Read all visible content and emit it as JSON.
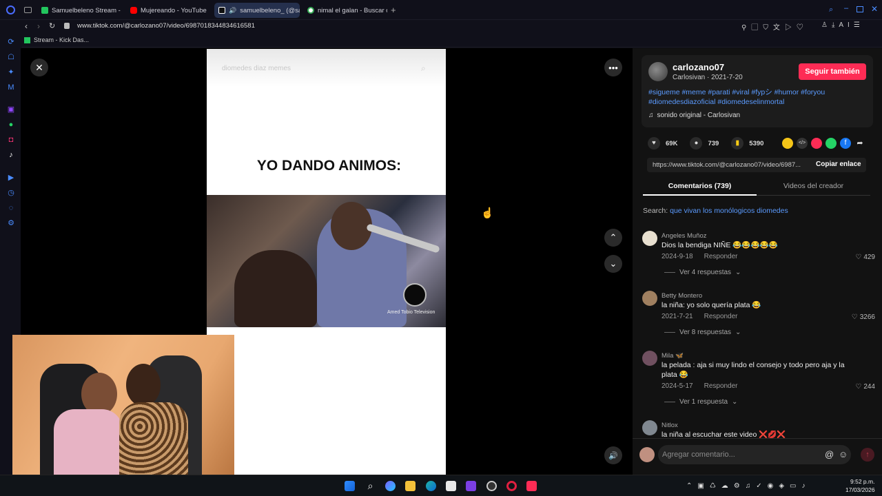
{
  "browser": {
    "tabs": [
      {
        "label": "Samuelbeleno Stream - W",
        "color": "#22c55e"
      },
      {
        "label": "Mujereando - YouTube",
        "color": "#ff0000"
      },
      {
        "label": "samuelbeleno_ (@sam",
        "color": "#ffffff"
      },
      {
        "label": "nimal el galan - Buscar co",
        "color": "#34a853"
      }
    ],
    "url": "www.tiktok.com/@carlozano07/video/6987018344834616581",
    "bookmark": "Stream - Kick Das..."
  },
  "video": {
    "search_placeholder": "diomedes diaz memes",
    "caption": "YO DANDO ANIMOS:",
    "watermark": "Amed Tobio Television"
  },
  "author": {
    "username": "carlozano07",
    "subline": "Carlosivan · 2021-7-20",
    "follow_label": "Seguir también",
    "hashtags": "#sigueme #meme #parati #viral #fypシ #humor #foryou #diomedesdiazoficial #diomedeselinmortal",
    "sound": "sonido original - Carlosivan"
  },
  "stats": {
    "likes": "69K",
    "comments": "739",
    "saves": "5390"
  },
  "share": {
    "link": "https://www.tiktok.com/@carlozano07/video/6987...",
    "copy_label": "Copiar enlace"
  },
  "tabs": {
    "comments": "Comentarios (739)",
    "creator_videos": "Videos del creador"
  },
  "search": {
    "prefix": "Search:",
    "query": "que vivan los monólogicos diomedes"
  },
  "comments": [
    {
      "name": "Angeles Muñoz",
      "text": "Dios la bendiga NIÑE 😂😂😂😂😂",
      "date": "2024-9-18",
      "reply_label": "Responder",
      "likes": "429",
      "replies": "Ver 4 respuestas",
      "avatar": "#e8e0d0"
    },
    {
      "name": "Betty Montero",
      "text": "la niña: yo solo quería plata 😂",
      "date": "2021-7-21",
      "reply_label": "Responder",
      "likes": "3266",
      "replies": "Ver 8 respuestas",
      "avatar": "#a08060"
    },
    {
      "name": "Mila 🦋",
      "text": "la pelada : aja si muy lindo el consejo y todo pero aja y la plata 😂",
      "date": "2024-5-17",
      "reply_label": "Responder",
      "likes": "244",
      "replies": "Ver 1 respuesta",
      "avatar": "#705060"
    },
    {
      "name": "Nitlox",
      "text": "la niña al escuchar este video ❌💋❌",
      "avatar": "#808890"
    }
  ],
  "comment_input": {
    "placeholder": "Agregar comentario..."
  },
  "taskbar": {
    "time": "9:52 p.m.",
    "date": "17/03/2026"
  }
}
